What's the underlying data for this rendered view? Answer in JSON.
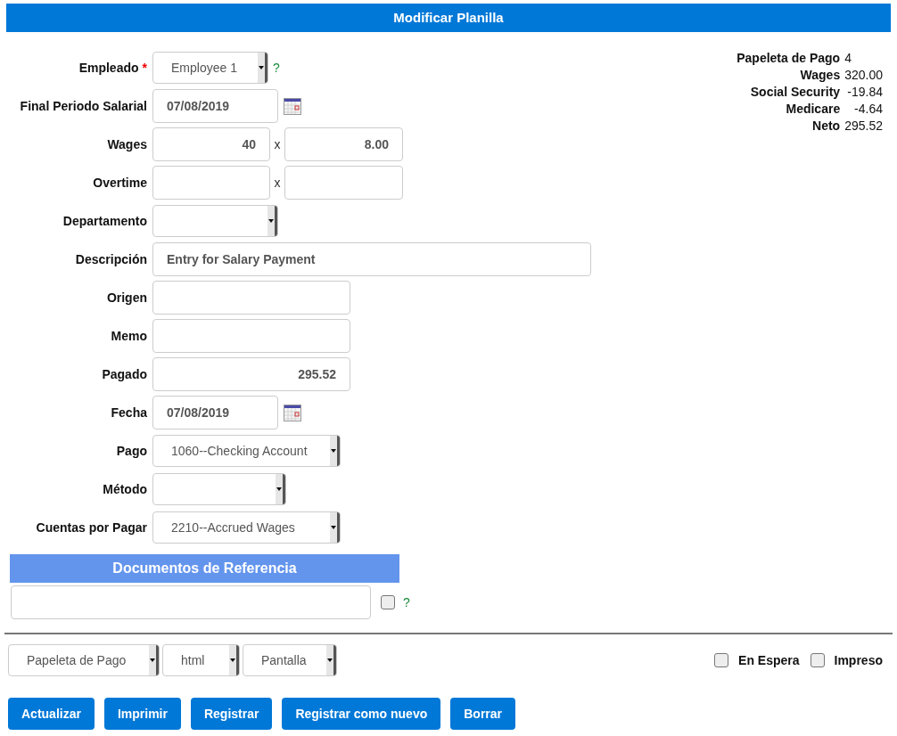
{
  "title": "Modificar Planilla",
  "fields": [
    {
      "kind": "select",
      "label": "Empleado",
      "required_mark": "*",
      "value": "Employee 1",
      "help": "?"
    },
    {
      "kind": "date",
      "label": "Final Periodo Salarial",
      "value": "07/08/2019"
    },
    {
      "kind": "pair",
      "label": "Wages",
      "value": "40",
      "separator": "x",
      "value_2": "8.00"
    },
    {
      "kind": "pair",
      "label": "Overtime",
      "separator": "x"
    },
    {
      "kind": "select",
      "label": "Departamento"
    },
    {
      "kind": "text",
      "label": "Descripción",
      "value": "Entry for Salary Payment"
    },
    {
      "kind": "text",
      "label": "Origen"
    },
    {
      "kind": "text",
      "label": "Memo"
    },
    {
      "kind": "number",
      "label": "Pagado",
      "value": "295.52"
    },
    {
      "kind": "date",
      "label": "Fecha",
      "value": "07/08/2019"
    },
    {
      "kind": "select",
      "label": "Pago",
      "value": "1060--Checking Account"
    },
    {
      "kind": "select",
      "label": "Método"
    },
    {
      "kind": "select",
      "label": "Cuentas por Pagar",
      "value": "2210--Accrued Wages"
    }
  ],
  "summary": [
    {
      "label": "Papeleta de Pago",
      "value": "4"
    },
    {
      "label": "Wages",
      "value": "320.00"
    },
    {
      "label": "Social Security",
      "value": "-19.84"
    },
    {
      "label": "Medicare",
      "value": "-4.64"
    },
    {
      "label": "Neto",
      "value": "295.52"
    }
  ],
  "reference_documents": {
    "title": "Documentos de Referencia",
    "checked": false,
    "help": "?"
  },
  "output_selects": [
    "Papeleta de Pago",
    "html",
    "Pantalla"
  ],
  "options": [
    {
      "label": "En Espera",
      "checked": false
    },
    {
      "label": "Impreso",
      "checked": false
    }
  ],
  "buttons": [
    "Actualizar",
    "Imprimir",
    "Registrar",
    "Registrar como nuevo",
    "Borrar"
  ]
}
